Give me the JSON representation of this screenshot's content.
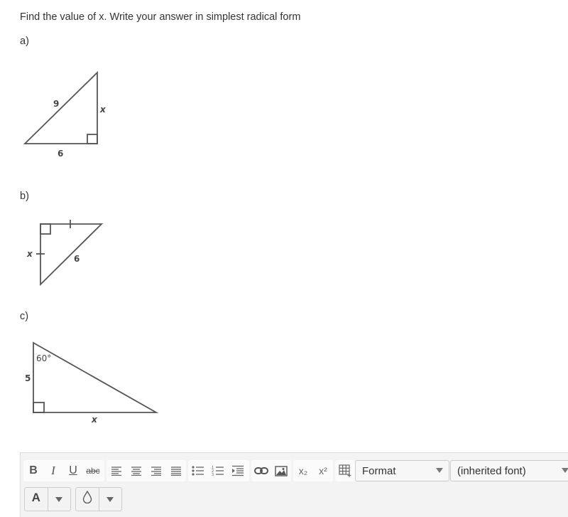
{
  "question": {
    "prompt": "Find the value of x. Write your answer in simplest radical form"
  },
  "parts": [
    {
      "label": "a)",
      "figure": {
        "hypotenuse": "9",
        "base": "6",
        "unknown": "x",
        "right_angle": "bottom-right"
      }
    },
    {
      "label": "b)",
      "figure": {
        "hypotenuse": "6",
        "unknown": "x",
        "congruent_legs": true,
        "right_angle": "top-left"
      }
    },
    {
      "label": "c)",
      "figure": {
        "angle": "60°",
        "side": "5",
        "unknown": "x",
        "right_angle": "bottom-left"
      }
    }
  ],
  "toolbar": {
    "buttons": [
      {
        "name": "bold",
        "label": "B"
      },
      {
        "name": "italic",
        "label": "I"
      },
      {
        "name": "underline",
        "label": "U"
      },
      {
        "name": "strikethrough",
        "label": "abc"
      },
      {
        "name": "align-left"
      },
      {
        "name": "align-center"
      },
      {
        "name": "align-right"
      },
      {
        "name": "align-justify"
      },
      {
        "name": "bullet-list"
      },
      {
        "name": "numbered-list"
      },
      {
        "name": "indent"
      },
      {
        "name": "link"
      },
      {
        "name": "image"
      },
      {
        "name": "subscript",
        "label": "x₂"
      },
      {
        "name": "superscript",
        "label": "x²"
      },
      {
        "name": "table"
      }
    ],
    "format_select": "Format",
    "font_select": "(inherited font)",
    "text_color_label": "A"
  }
}
